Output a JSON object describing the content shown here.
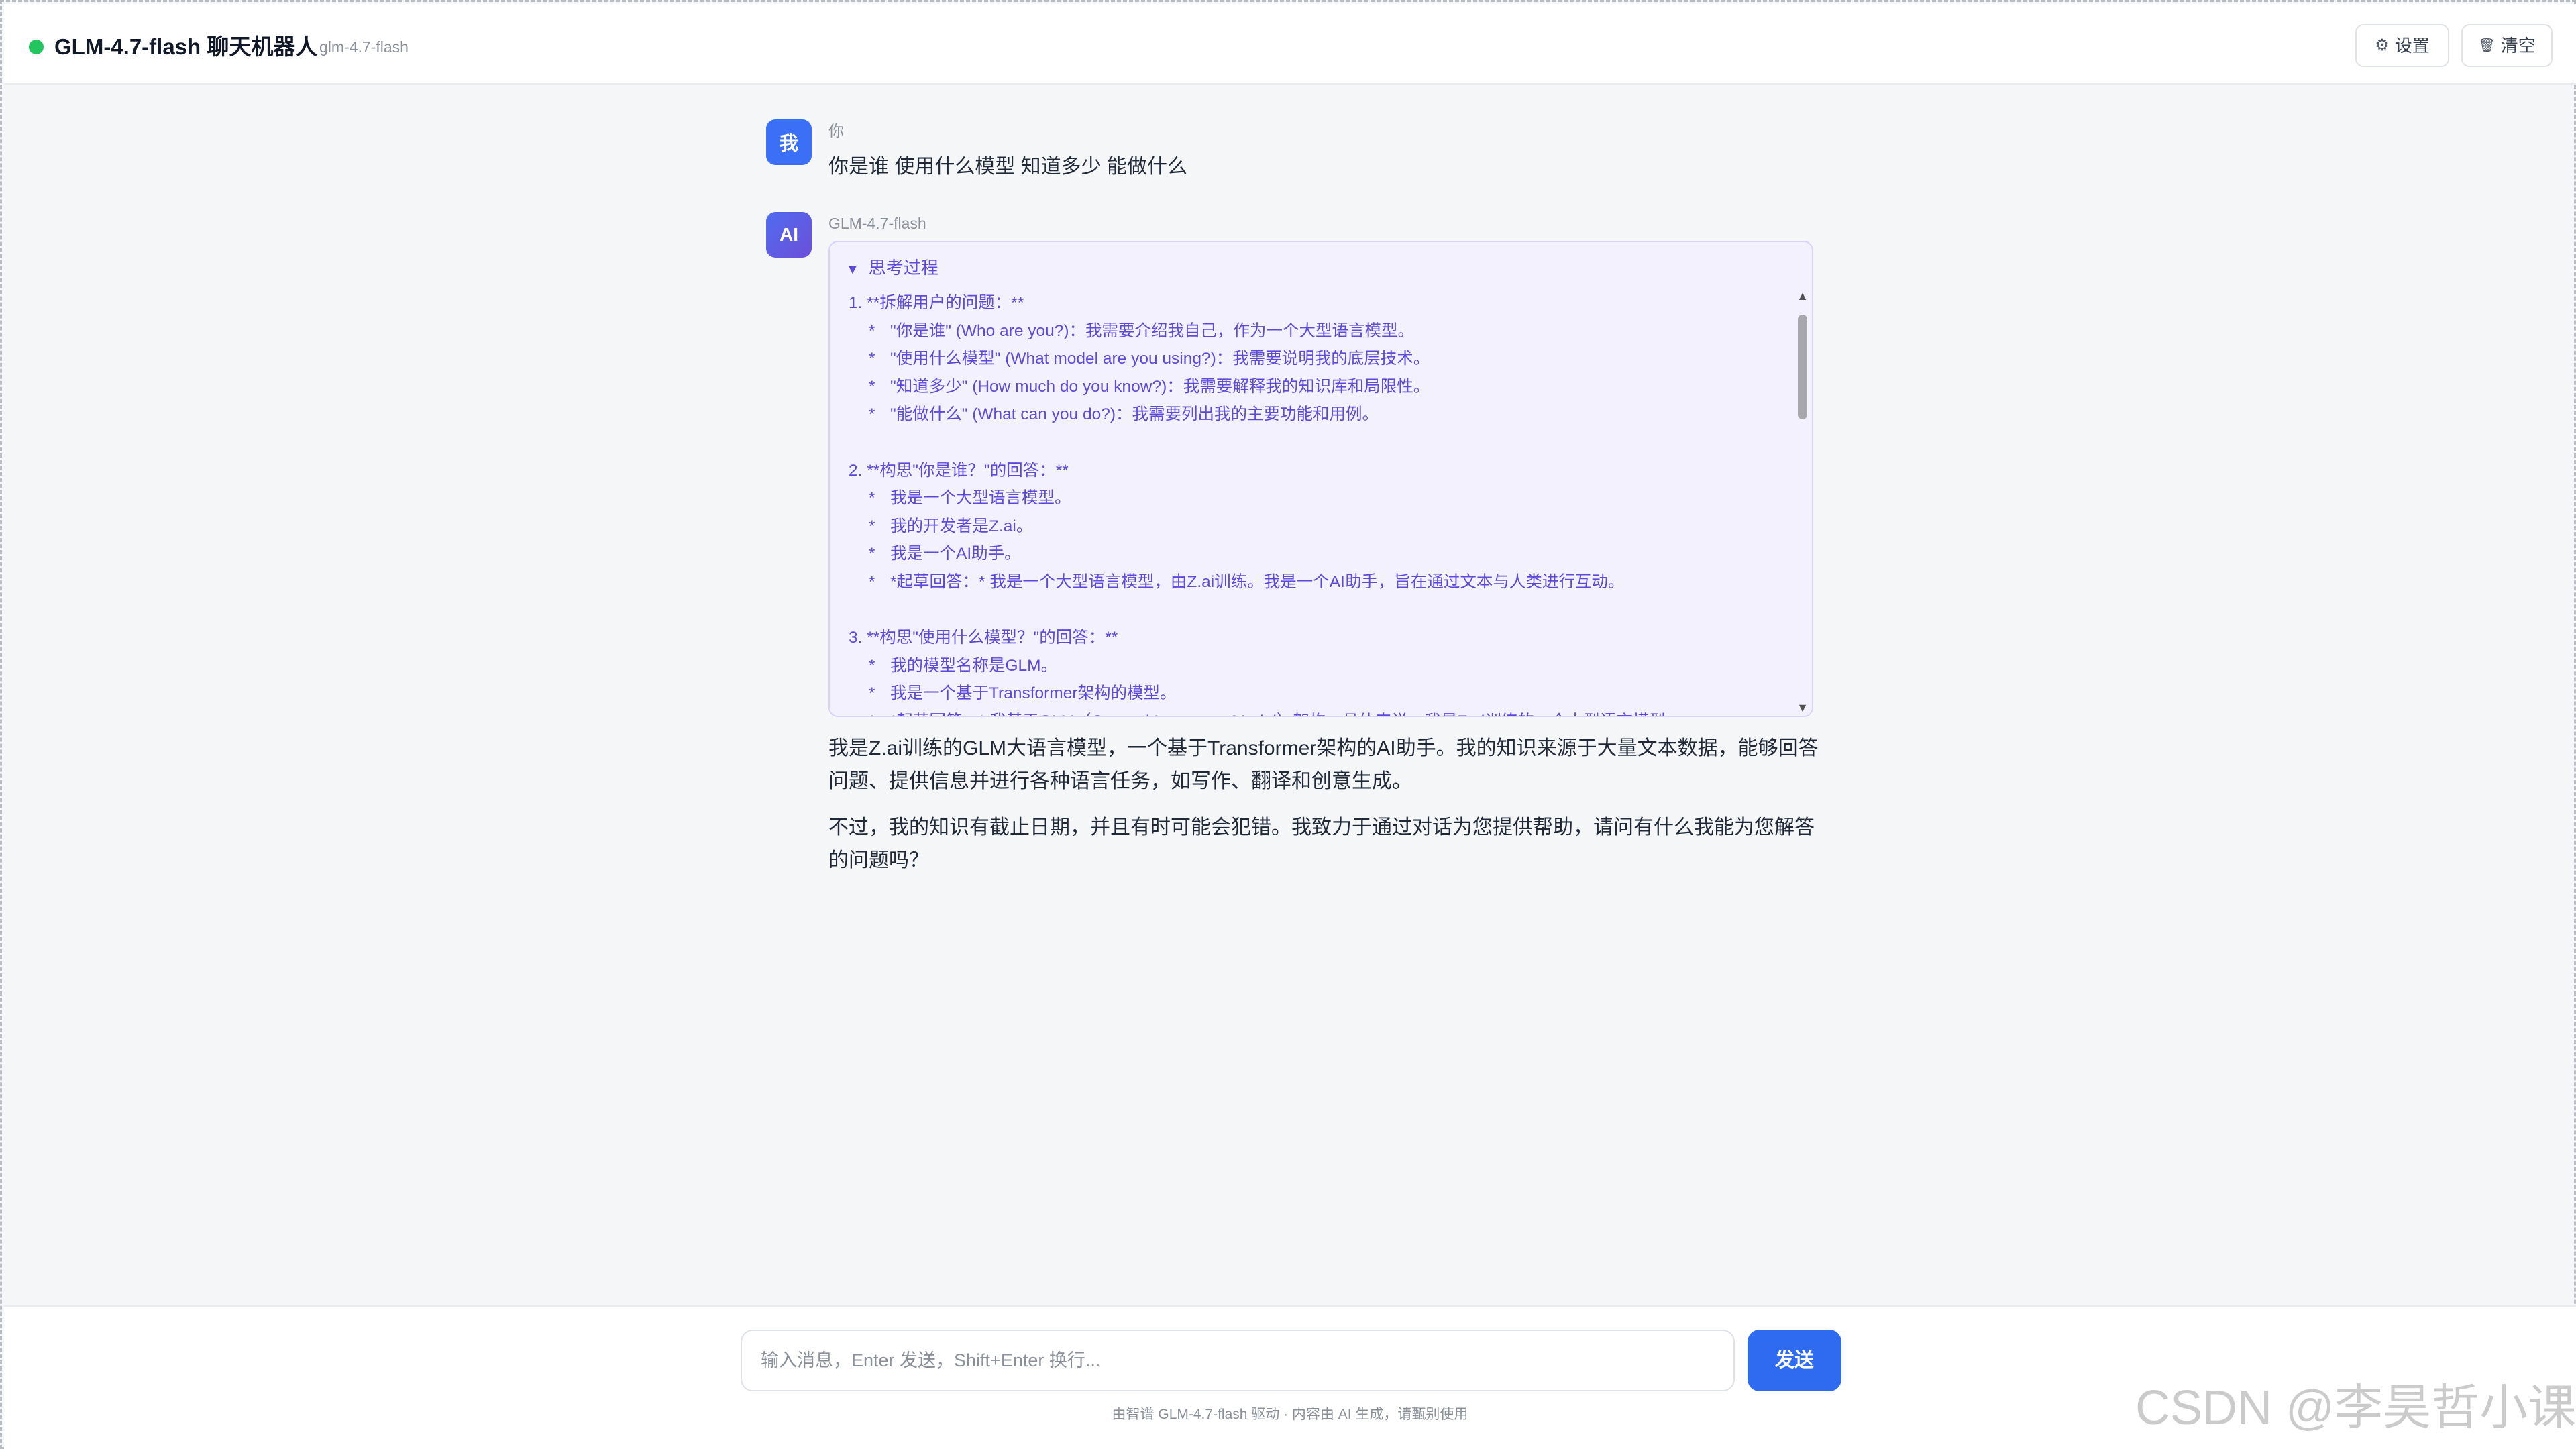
{
  "header": {
    "title": "GLM-4.7-flash 聊天机器人",
    "model_tag": "glm-4.7-flash",
    "settings_icon": "⚙",
    "settings_label": "设置",
    "clear_icon": "🗑",
    "clear_label": "清空",
    "status_color": "#22c55e"
  },
  "conversation": {
    "user": {
      "avatar": "我",
      "name": "你",
      "message": "你是谁 使用什么模型 知道多少 能做什么"
    },
    "ai": {
      "avatar": "AI",
      "name": "GLM-4.7-flash",
      "thinking": {
        "toggle_icon": "▼",
        "title": "思考过程",
        "lines": [
          {
            "text": "1. **拆解用户的问题：**",
            "indent": false
          },
          {
            "text": "\"你是谁\" (Who are you?)：我需要介绍我自己，作为一个大型语言模型。",
            "indent": true
          },
          {
            "text": "\"使用什么模型\" (What model are you using?)：我需要说明我的底层技术。",
            "indent": true
          },
          {
            "text": "\"知道多少\" (How much do you know?)：我需要解释我的知识库和局限性。",
            "indent": true
          },
          {
            "text": "\"能做什么\" (What can you do?)：我需要列出我的主要功能和用例。",
            "indent": true
          },
          {
            "text": "",
            "indent": false
          },
          {
            "text": "2. **构思\"你是谁？\"的回答：**",
            "indent": false
          },
          {
            "text": "我是一个大型语言模型。",
            "indent": true
          },
          {
            "text": "我的开发者是Z.ai。",
            "indent": true
          },
          {
            "text": "我是一个AI助手。",
            "indent": true
          },
          {
            "text": "*起草回答：* 我是一个大型语言模型，由Z.ai训练。我是一个AI助手，旨在通过文本与人类进行互动。",
            "indent": true
          },
          {
            "text": "",
            "indent": false
          },
          {
            "text": "3. **构思\"使用什么模型？\"的回答：**",
            "indent": false
          },
          {
            "text": "我的模型名称是GLM。",
            "indent": true
          },
          {
            "text": "我是一个基于Transformer架构的模型。",
            "indent": true
          },
          {
            "text": "*起草回答：* 我基于GLM（General Language Model）架构。具体来说，我是Z.ai训练的一个大型语言模型。",
            "indent": true
          }
        ]
      },
      "answer": [
        "我是Z.ai训练的GLM大语言模型，一个基于Transformer架构的AI助手。我的知识来源于大量文本数据，能够回答问题、提供信息并进行各种语言任务，如写作、翻译和创意生成。",
        "不过，我的知识有截止日期，并且有时可能会犯错。我致力于通过对话为您提供帮助，请问有什么我能为您解答的问题吗？"
      ]
    }
  },
  "composer": {
    "value": "",
    "placeholder": "输入消息，Enter 发送，Shift+Enter 换行...",
    "send_label": "发送",
    "send_color": "#2f6bf0"
  },
  "footer": {
    "disclaimer": "由智谱 GLM-4.7-flash 驱动 · 内容由 AI 生成，请甄别使用"
  },
  "watermark": "CSDN @李昊哲小课",
  "scrollbar": {
    "up_icon": "▲",
    "down_icon": "▼",
    "position_fraction": 0.0
  }
}
